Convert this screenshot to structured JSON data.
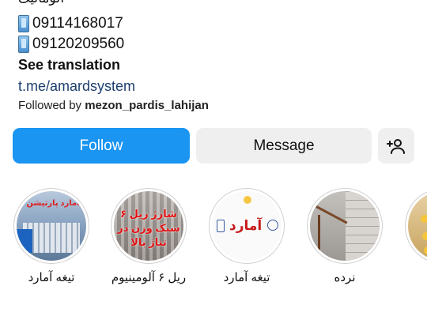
{
  "bio": {
    "cut_line": "آلومانیک",
    "phones": [
      "09114168017",
      "09120209560"
    ],
    "see_translation": "See translation",
    "link": "t.me/amardsystem",
    "followed_prefix": "Followed by ",
    "followed_user": "mezon_pardis_lahijan"
  },
  "actions": {
    "follow_label": "Follow",
    "message_label": "Message",
    "add_user_icon": "add-user-icon"
  },
  "colors": {
    "follow_bg": "#1a95f2",
    "secondary_bg": "#efefef",
    "link": "#1c3f6e"
  },
  "highlights": [
    {
      "label": "تیغه آمارد",
      "image_text": "آمارد پارتیشن"
    },
    {
      "label": "ریل ۶ آلومینیوم",
      "image_text": "شارژ ریل ۶ سبک وزن در تناژ بالا"
    },
    {
      "label": "تیغه آمارد",
      "image_text": "آمارد"
    },
    {
      "label": "نرده",
      "image_text": ""
    },
    {
      "label": "",
      "image_text": ""
    }
  ]
}
